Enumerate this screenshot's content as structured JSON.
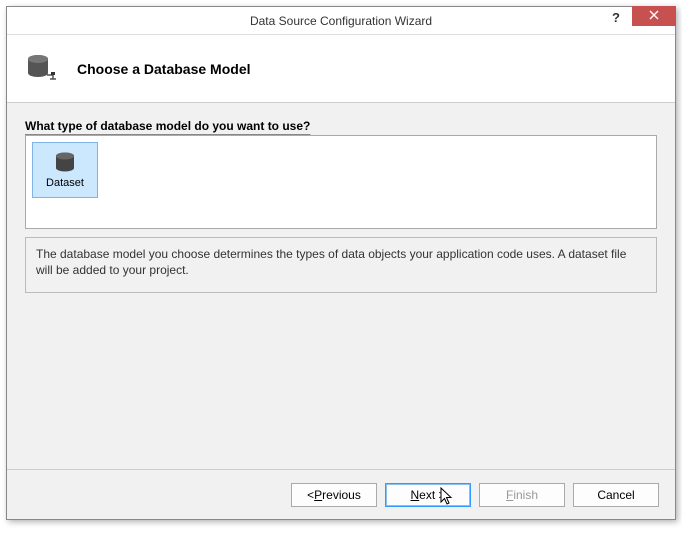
{
  "titlebar": {
    "title": "Data Source Configuration Wizard"
  },
  "header": {
    "title": "Choose a Database Model"
  },
  "main": {
    "prompt": "What type of database model do you want to use?",
    "options": [
      {
        "label": "Dataset"
      }
    ],
    "description": "The database model you choose determines the types of data objects your application code uses. A dataset file will be added to your project."
  },
  "footer": {
    "previous": "Previous",
    "next": "Next >",
    "finish": "Finish",
    "cancel": "Cancel"
  }
}
